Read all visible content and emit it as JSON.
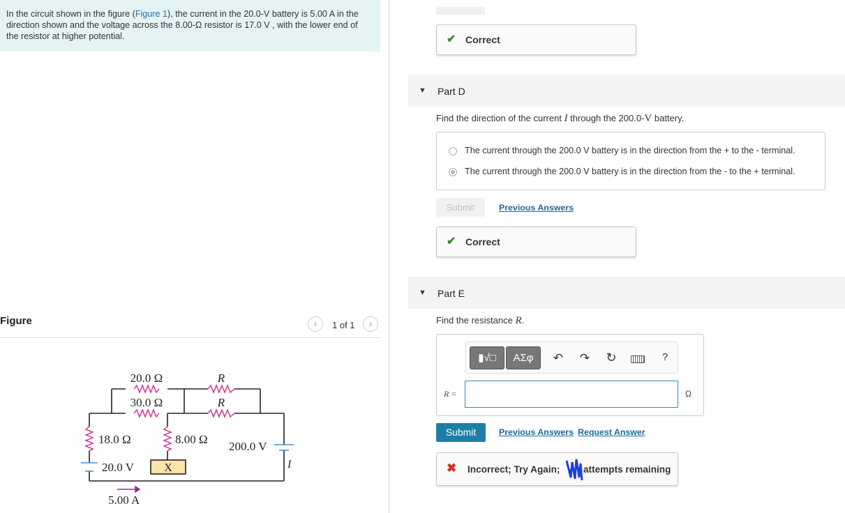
{
  "problem": {
    "text_1": "In the circuit shown in the figure (",
    "figure_link": "Figure 1",
    "text_2": "), the current in the 20.0-V battery is 5.00 A in the direction shown and the voltage across the 8.00-Ω resistor is 17.0 V , with the lower end of the resistor at higher potential."
  },
  "figure": {
    "label": "Figure",
    "pager": "1 of 1",
    "prev_icon": "chevron-left-icon",
    "next_icon": "chevron-right-icon",
    "circuit": {
      "r_top1": "20.0 Ω",
      "r_top2": "30.0 Ω",
      "r_unknown1": "R",
      "r_unknown2": "R",
      "r_left": "18.0 Ω",
      "r_mid": "8.00 Ω",
      "battery_right": "200.0 V",
      "current_right": "I",
      "battery_left": "20.0 V",
      "box_label": "X",
      "current_left": "5.00 A"
    }
  },
  "part_c": {
    "status": "Correct"
  },
  "part_d": {
    "label": "Part D",
    "question_1": "Find the direction of the current ",
    "question_var": "I",
    "question_2": " through the 200.0-",
    "question_unit": "V",
    "question_3": " battery.",
    "options": [
      {
        "text": "The current through the 200.0 V battery is in the direction from the + to the - terminal.",
        "selected": false
      },
      {
        "text": "The current through the 200.0 V battery is in the direction from the - to the + terminal.",
        "selected": true
      }
    ],
    "submit_label": "Submit",
    "previous_answers": "Previous Answers",
    "status": "Correct"
  },
  "part_e": {
    "label": "Part E",
    "question_1": "Find the resistance ",
    "question_var": "R",
    "question_2": ".",
    "toolbar": {
      "templates_icon": "templates-icon",
      "greek_label": "ΑΣφ",
      "undo_icon": "undo-icon",
      "redo_icon": "redo-icon",
      "reset_icon": "reset-icon",
      "keyboard_icon": "keyboard-icon",
      "help_label": "?"
    },
    "input_label": "R =",
    "input_value": "",
    "unit": "Ω",
    "submit_label": "Submit",
    "previous_answers": "Previous Answers",
    "request_answer": "Request Answer",
    "feedback": "Incorrect; Try Again; ",
    "feedback_tail": "attempts remaining"
  },
  "colors": {
    "accent": "#1d7fa6",
    "correct": "#3a8a2e",
    "incorrect": "#d62d20",
    "problem_bg": "#e6f3f4"
  }
}
